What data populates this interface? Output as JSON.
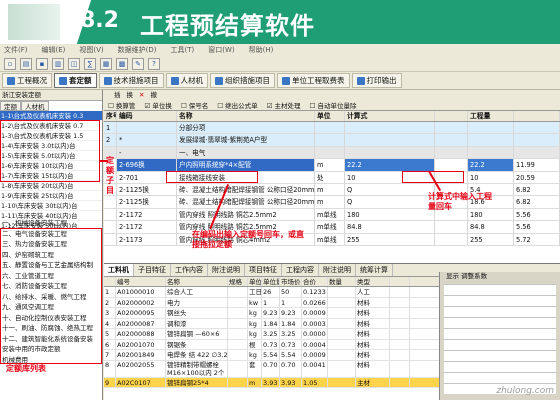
{
  "slide": {
    "number": "8.2",
    "title": "工程预结算软件"
  },
  "menubar": [
    "文件(F)",
    "编辑(E)",
    "视图(V)",
    "数据维护(D)",
    "工具(T)",
    "窗口(W)",
    "帮助(H)"
  ],
  "main_tabs": [
    "工程概况",
    "套定额",
    "技术措施项目",
    "人材机",
    "组织措施项目",
    "单位工程取费表",
    "打印输出"
  ],
  "left_panel": {
    "header": "浙江安装定额",
    "tabs": [
      "定额",
      "人材机"
    ],
    "quota_items": [
      "1-1\\台式及仪表机床安装  0.3",
      "1-2\\台式及仪表机床安装  0.7",
      "1-3\\台式及仪表机床安装  1.5",
      "1-4\\车床安装  3.0t以内)台",
      "1-5\\车床安装  5.0t以内)台",
      "1-6\\车床安装  10t以内)台",
      "1-7\\车床安装  15t以内)台",
      "1-8\\车床安装  20t以内)台",
      "1-9\\车床安装  25t以内)台",
      "1-10\\车床安装  30t以内)台",
      "1-11\\车床安装  40t以内)台",
      "1-12\\车床安装  50t以内)台"
    ],
    "library_tree": [
      "一、机械设备安装工程",
      "二、电气设备安装工程",
      "三、热力设备安装工程",
      "四、炉窑砌筑工程",
      "五、静置设备与工艺金属结构制",
      "六、工业管道工程",
      "七、消防设备安装工程",
      "八、给排水、采暖、燃气工程",
      "九、通风空调工程",
      "十、自动化控制仪表安装工程",
      "十一、刷油、防腐蚀、绝热工程",
      "十二、建筑智能化系统设备安装",
      "安装中用的市政定额",
      "机械费用"
    ]
  },
  "main": {
    "toolbar": [
      "插",
      "换",
      "删",
      "撤"
    ],
    "options": [
      "换算管",
      "单位换",
      "保号名",
      "继出公式单",
      "主材处理",
      "自动单位量除"
    ],
    "columns": [
      "序号",
      "编码",
      "名称",
      "单位",
      "计算式",
      "工程量",
      ""
    ],
    "rows": [
      {
        "seq": "1",
        "code": "",
        "name": "分部分项",
        "unit": "",
        "formula": "",
        "expr": "",
        "qty": "",
        "last": ""
      },
      {
        "seq": "2",
        "code": "*",
        "name": "发展绿城·翡翠城-紫荆苑A户型",
        "unit": "",
        "formula": "",
        "expr": "",
        "qty": "",
        "last": ""
      },
      {
        "seq": "",
        "code": "-",
        "name": "一、电气",
        "unit": "",
        "formula": "",
        "expr": "",
        "qty": "",
        "last": ""
      },
      {
        "seq": "",
        "code": "2-696换",
        "name": "户内照明系统穿*4×配管",
        "unit": "m",
        "formula": "22.2",
        "expr": "",
        "qty": "22.2",
        "last": "11.99"
      },
      {
        "seq": "",
        "code": "2-701",
        "name": "接线箱接线安装",
        "unit": "处",
        "formula": "10",
        "expr": "",
        "qty": "10",
        "last": "20.59"
      },
      {
        "seq": "",
        "code": "2-1125换",
        "name": "砖、混凝土结构暗配焊接钢管 公称口径20mm",
        "unit": "m",
        "formula": "Q",
        "expr": "",
        "qty": "5.4",
        "last": "6.82"
      },
      {
        "seq": "",
        "code": "2-1125换",
        "name": "砖、混凝土结构暗配焊接钢管 公称口径20mm",
        "unit": "m",
        "formula": "Q",
        "expr": "",
        "qty": "18.6",
        "last": "6.82"
      },
      {
        "seq": "",
        "code": "2-1172",
        "name": "管内穿线 照明线路 铜芯2.5mm2",
        "unit": "m单线",
        "formula": "180",
        "expr": "",
        "qty": "180",
        "last": "5.56"
      },
      {
        "seq": "",
        "code": "2-1172",
        "name": "管内穿线 照明线路 铜芯2.5mm2",
        "unit": "m单线",
        "formula": "84.8",
        "expr": "",
        "qty": "84.8",
        "last": "5.56"
      },
      {
        "seq": "",
        "code": "2-1173",
        "name": "管内穿线 照明线路 铜芯4mm2",
        "unit": "m单线",
        "formula": "255",
        "expr": "",
        "qty": "255",
        "last": "5.72"
      }
    ]
  },
  "bottom": {
    "tabs": [
      "工料机",
      "子目特征",
      "工作内容",
      "附注说明",
      "项目特征",
      "工程内容",
      "附注说明",
      "统筹计算"
    ],
    "columns": [
      "",
      "编号",
      "名称",
      "规格",
      "单位",
      "单位量",
      "市场价",
      "合价",
      "数量",
      "类型",
      ""
    ],
    "rows": [
      {
        "no": "1",
        "code": "A01000010",
        "name": "综合人工",
        "spec": "",
        "unit": "工日",
        "qty": "26",
        "mp": "50",
        "cp": "0.1233",
        "cnt": "",
        "type": "人工",
        "lk": ""
      },
      {
        "no": "2",
        "code": "A02000002",
        "name": "电力",
        "spec": "",
        "unit": "kw",
        "qty": "1",
        "mp": "1",
        "cp": "0.0266",
        "cnt": "",
        "type": "材料",
        "lk": ""
      },
      {
        "no": "3",
        "code": "A02000095",
        "name": "钢丝头",
        "spec": "",
        "unit": "kg",
        "qty": "9.23",
        "mp": "9.23",
        "cp": "0.0009",
        "cnt": "",
        "type": "材料",
        "lk": ""
      },
      {
        "no": "4",
        "code": "A02000087",
        "name": "调和漆",
        "spec": "",
        "unit": "kg",
        "qty": "1.84",
        "mp": "1.84",
        "cp": "0.0003",
        "cnt": "",
        "type": "材料",
        "lk": ""
      },
      {
        "no": "5",
        "code": "A02000088",
        "name": "镀锌扁钢 —60×6",
        "spec": "",
        "unit": "kg",
        "qty": "3.25",
        "mp": "3.25",
        "cp": "0.0000",
        "cnt": "",
        "type": "材料",
        "lk": ""
      },
      {
        "no": "6",
        "code": "A02001070",
        "name": "钢锯条",
        "spec": "",
        "unit": "根",
        "qty": "0.73",
        "mp": "0.73",
        "cp": "0.0004",
        "cnt": "",
        "type": "材料",
        "lk": ""
      },
      {
        "no": "7",
        "code": "A02001849",
        "name": "电焊条 结 422 ∅3.2",
        "spec": "",
        "unit": "kg",
        "qty": "5.54",
        "mp": "5.54",
        "cp": "0.0009",
        "cnt": "",
        "type": "材料",
        "lk": ""
      },
      {
        "no": "8",
        "code": "A02002055",
        "name": "镀锌精制带帽螺栓 M16×100以内 2个1弹垫",
        "spec": "",
        "unit": "套",
        "qty": "0.70",
        "mp": "0.70",
        "cp": "0.0041",
        "cnt": "",
        "type": "材料",
        "lk": ""
      },
      {
        "no": "9",
        "code": "A02C0107",
        "name": "镀锌扁钢25*4",
        "spec": "",
        "unit": "m",
        "qty": "3.93",
        "mp": "3.93",
        "cp": "1.05",
        "cnt": "",
        "type": "主材",
        "lk": ""
      }
    ]
  },
  "side_panel": {
    "header": "显示 调整系数"
  },
  "annotations": {
    "quota_sub": "定额子目",
    "quota_lib": "定额库列表",
    "input_code": "在编码出输入定额号回车，或直接拖拉定额",
    "calc": "计算式中输入工程量回车"
  },
  "watermark": "zhulong.com",
  "colors": {
    "header_green": "#1f9e76",
    "annotation_red": "#e60012",
    "selection_blue": "#316ac5",
    "highlight_yellow": "#ffd34a"
  }
}
